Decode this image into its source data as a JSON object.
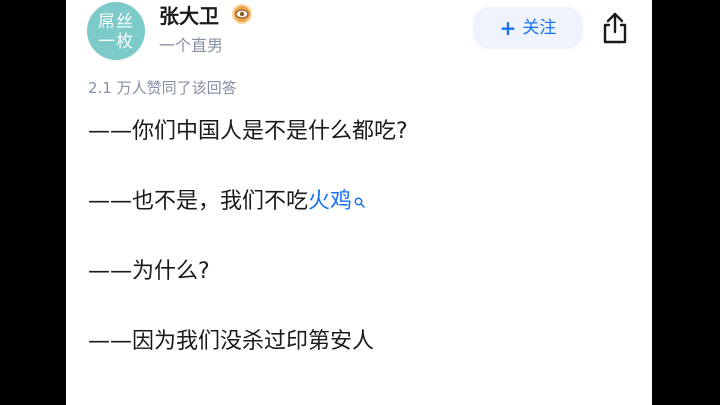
{
  "author": {
    "avatar_text": [
      "屌丝",
      "一枚"
    ],
    "name": "张大卫",
    "bio": "一个直男",
    "badge_icon": "eye-badge-icon"
  },
  "follow_button": {
    "icon": "+",
    "label": "关注"
  },
  "share_icon": "share-icon",
  "upvote_text": "2.1 万人赞同了该回答",
  "content": {
    "para1": "——你们中国人是不是什么都吃?",
    "para2_prefix": "——也不是，我们不吃",
    "para2_keyword": "火鸡",
    "para3": "——为什么?",
    "para4": "——因为我们没杀过印第安人"
  },
  "colors": {
    "accent": "#1772f6",
    "follow_bg": "#eef3fd",
    "muted": "#8590a6",
    "avatar_bg": "#7ccbc8",
    "badge": "#f0a24a",
    "letterbox": "#000000"
  }
}
